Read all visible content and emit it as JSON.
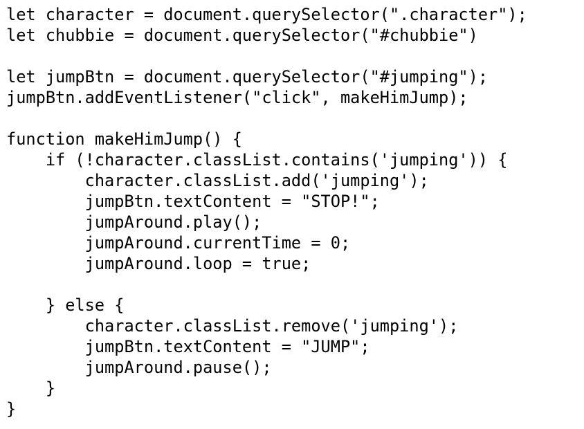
{
  "editor": {
    "lines": [
      "let character = document.querySelector(\".character\");",
      "let chubbie = document.querySelector(\"#chubbie\")",
      "",
      "let jumpBtn = document.querySelector(\"#jumping\");",
      "jumpBtn.addEventListener(\"click\", makeHimJump);",
      "",
      "function makeHimJump() {",
      "    if (!character.classList.contains('jumping')) {",
      "        character.classList.add('jumping');",
      "        jumpBtn.textContent = \"STOP!\";",
      "        jumpAround.play();",
      "        jumpAround.currentTime = 0;",
      "        jumpAround.loop = true;",
      "",
      "    } else {",
      "        character.classList.remove('jumping');",
      "        jumpBtn.textContent = \"JUMP\";",
      "        jumpAround.pause();",
      "    }",
      "}"
    ]
  }
}
